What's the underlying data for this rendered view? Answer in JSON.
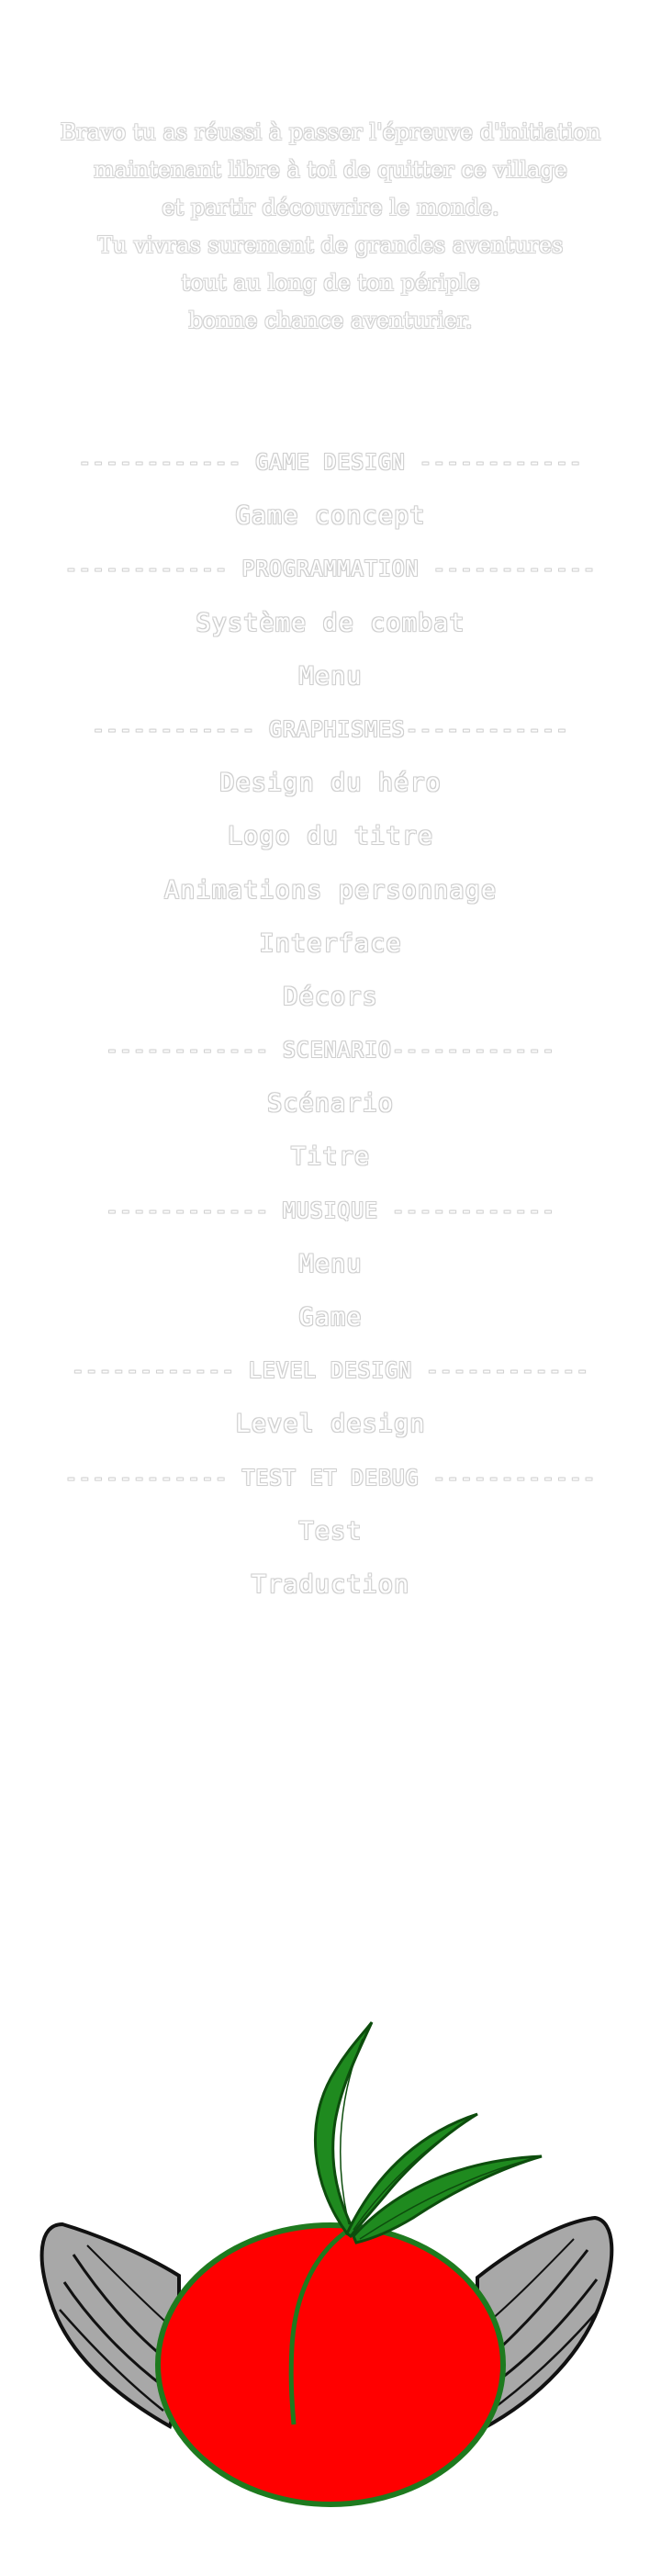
{
  "intro": {
    "lines": [
      "Bravo tu as réussi à passer l'épreuve d'initiation",
      "maintenant libre à toi de quitter ce village",
      "et partir découvrire le monde.",
      "Tu vivras surement de grandes aventures",
      "tout au long de ton périple",
      "bonne chance aventurier."
    ]
  },
  "credits": {
    "rows": [
      {
        "kind": "section",
        "text": "------------ GAME DESIGN ------------"
      },
      {
        "kind": "entry",
        "text": "Game concept"
      },
      {
        "kind": "section",
        "text": "------------ PROGRAMMATION ------------"
      },
      {
        "kind": "entry",
        "text": "Système de combat"
      },
      {
        "kind": "entry",
        "text": "Menu"
      },
      {
        "kind": "section",
        "text": "------------ GRAPHISMES------------"
      },
      {
        "kind": "entry",
        "text": "Design du héro"
      },
      {
        "kind": "entry",
        "text": "Logo du titre"
      },
      {
        "kind": "entry",
        "text": "Animations personnage"
      },
      {
        "kind": "entry",
        "text": "Interface"
      },
      {
        "kind": "entry",
        "text": "Décors"
      },
      {
        "kind": "section",
        "text": "------------ SCENARIO------------"
      },
      {
        "kind": "entry",
        "text": "Scénario"
      },
      {
        "kind": "entry",
        "text": "Titre"
      },
      {
        "kind": "section",
        "text": "------------ MUSIQUE ------------"
      },
      {
        "kind": "entry",
        "text": "Menu"
      },
      {
        "kind": "entry",
        "text": "Game"
      },
      {
        "kind": "section",
        "text": "------------ LEVEL DESIGN ------------"
      },
      {
        "kind": "entry",
        "text": "Level design"
      },
      {
        "kind": "section",
        "text": "------------ TEST ET DEBUG ------------"
      },
      {
        "kind": "entry",
        "text": "Test"
      },
      {
        "kind": "entry",
        "text": "Traduction"
      }
    ]
  },
  "logo": {
    "icon": "winged-tomato-logo-icon",
    "colors": {
      "fruit": "#ff0000",
      "fruit_outline": "#1e7a1e",
      "leaves": "#1f8a1f",
      "leaves_dark": "#0d4d0d",
      "wings": "#a8a8a8",
      "wings_outline": "#111111"
    }
  }
}
